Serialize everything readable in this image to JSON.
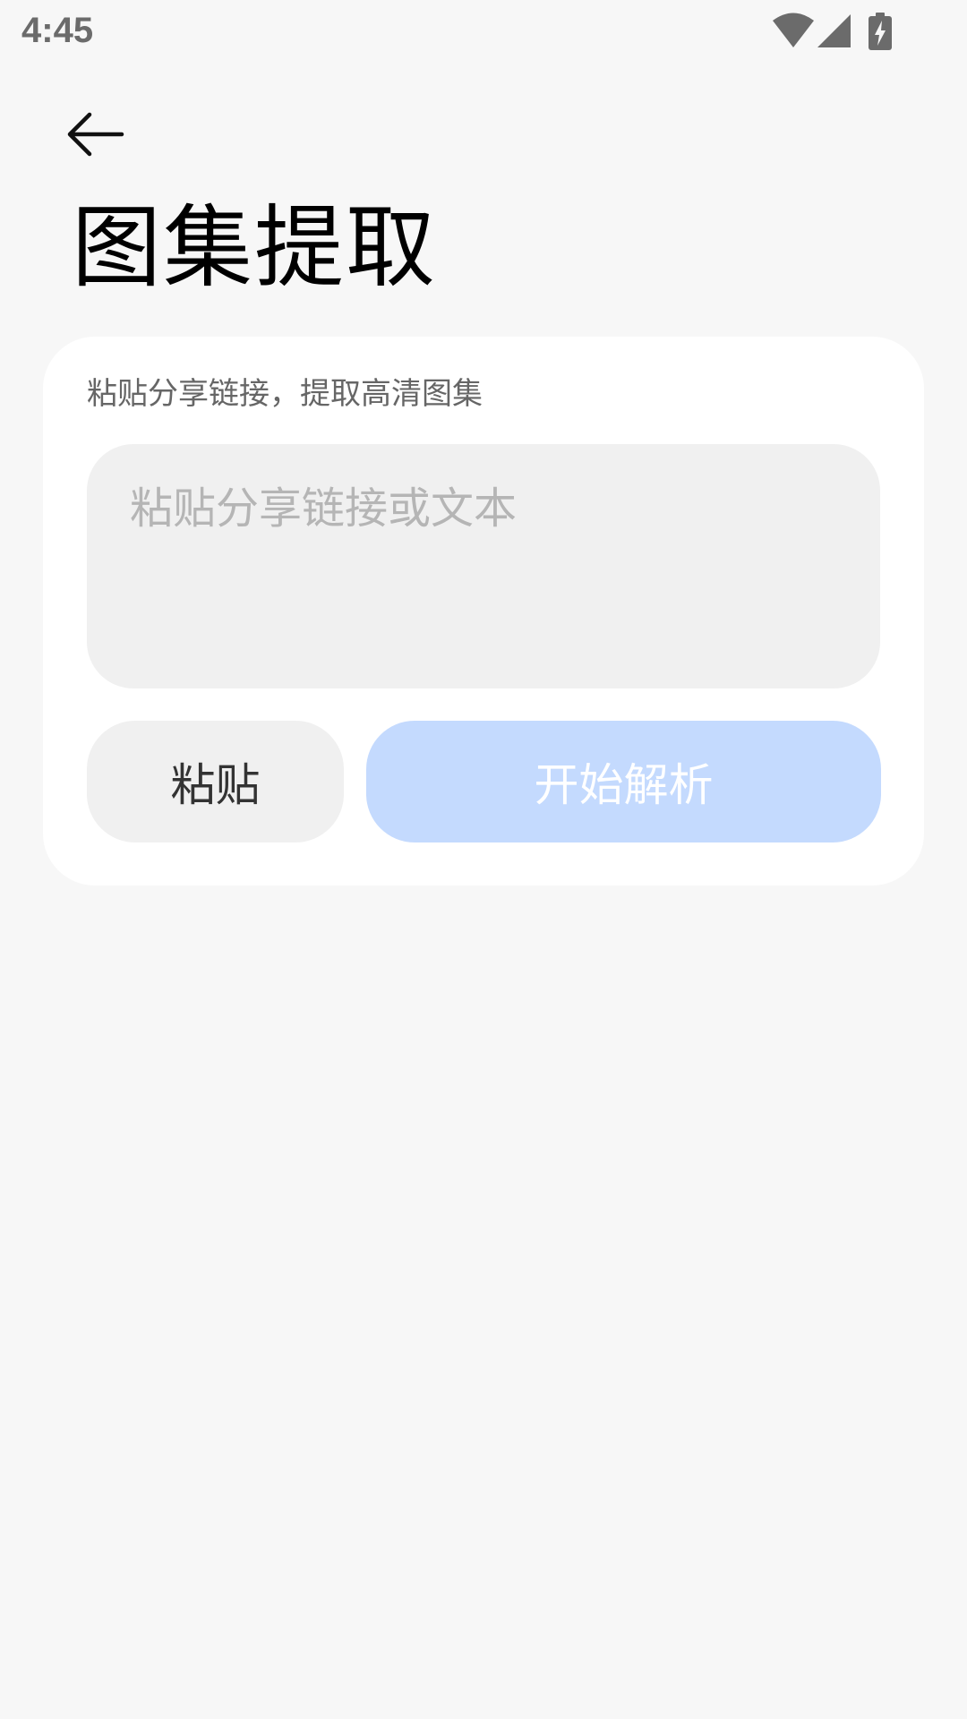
{
  "status_bar": {
    "time": "4:45",
    "icons": [
      "wifi-icon",
      "cellular-signal-icon",
      "battery-charging-icon"
    ]
  },
  "header": {
    "back_icon": "arrow-left-icon",
    "title": "图集提取"
  },
  "card": {
    "hint": "粘贴分享链接，提取高清图集",
    "input": {
      "value": "",
      "placeholder": "粘贴分享链接或文本"
    },
    "paste_label": "粘贴",
    "parse_label": "开始解析"
  },
  "colors": {
    "background": "#f7f7f7",
    "card": "#ffffff",
    "input_bg": "#f0f0f0",
    "primary_disabled": "#c4dafe"
  }
}
